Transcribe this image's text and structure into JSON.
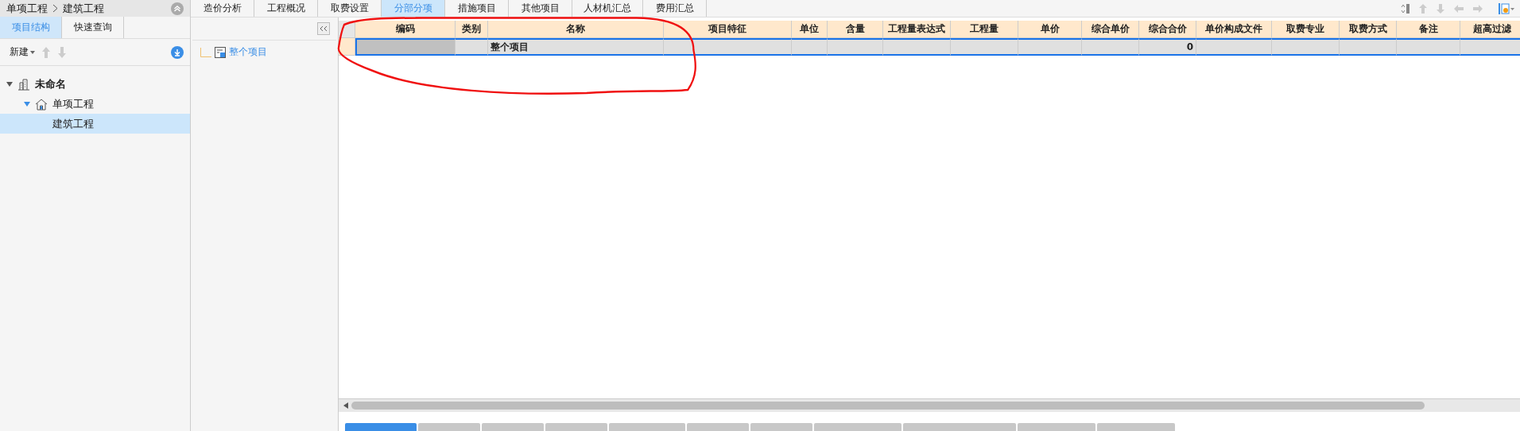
{
  "breadcrumb": [
    "单项工程",
    "建筑工程"
  ],
  "left_tabs": [
    {
      "label": "项目结构",
      "selected": true
    },
    {
      "label": "快速查询",
      "selected": false
    }
  ],
  "toolbar": {
    "new_label": "新建"
  },
  "tree": [
    {
      "label": "未命名",
      "kind": "project",
      "expanded": true,
      "selected": false,
      "children": [
        {
          "label": "单项工程",
          "kind": "unit",
          "expanded": true,
          "selected": false,
          "children": [
            {
              "label": "建筑工程",
              "selected": true
            }
          ]
        }
      ]
    }
  ],
  "outline": [
    {
      "label": "整个项目"
    }
  ],
  "tabs": [
    {
      "label": "造价分析",
      "selected": false
    },
    {
      "label": "工程概况",
      "selected": false
    },
    {
      "label": "取费设置",
      "selected": false
    },
    {
      "label": "分部分项",
      "selected": true
    },
    {
      "label": "措施项目",
      "selected": false
    },
    {
      "label": "其他项目",
      "selected": false
    },
    {
      "label": "人材机汇总",
      "selected": false
    },
    {
      "label": "费用汇总",
      "selected": false
    }
  ],
  "table": {
    "columns": [
      "编码",
      "类别",
      "名称",
      "项目特征",
      "单位",
      "含量",
      "工程量表达式",
      "工程量",
      "单价",
      "综合单价",
      "综合合价",
      "单价构成文件",
      "取费专业",
      "取费方式",
      "备注",
      "超高过滤"
    ],
    "rows": [
      {
        "selected": true,
        "cells": [
          "",
          "",
          "整个项目",
          "",
          "",
          "",
          "",
          "",
          "",
          "",
          "0",
          "",
          "",
          "",
          "",
          ""
        ]
      }
    ]
  },
  "bottom_tabs": [
    {
      "selected": true
    },
    {
      "selected": false
    },
    {
      "selected": false
    },
    {
      "selected": false
    },
    {
      "selected": false
    },
    {
      "selected": false
    },
    {
      "selected": false
    },
    {
      "selected": false
    },
    {
      "selected": false
    },
    {
      "selected": false
    },
    {
      "selected": false
    }
  ]
}
